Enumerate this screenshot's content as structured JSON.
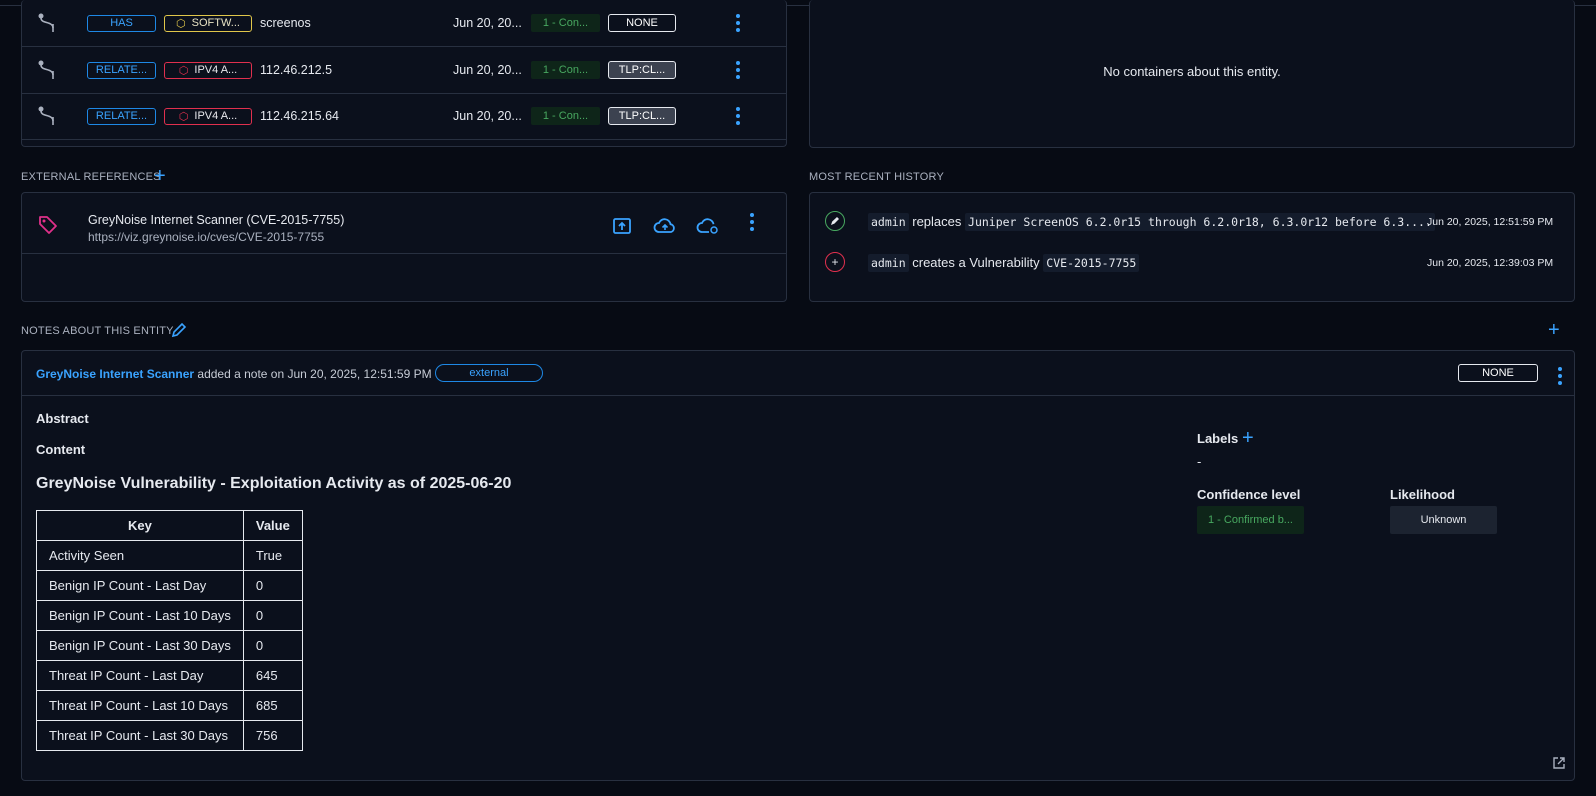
{
  "relations": {
    "rows": [
      {
        "type": "HAS",
        "entity_type": "SOFTW...",
        "entity_color": "yellow",
        "name": "screenos",
        "date": "Jun 20, 20...",
        "confidence": "1 - Con...",
        "marking": "NONE"
      },
      {
        "type": "RELATE...",
        "entity_type": "IPV4 A...",
        "entity_color": "red",
        "name": "112.46.212.5",
        "date": "Jun 20, 20...",
        "confidence": "1 - Con...",
        "marking": "TLP:CL..."
      },
      {
        "type": "RELATE...",
        "entity_type": "IPV4 A...",
        "entity_color": "red",
        "name": "112.46.215.64",
        "date": "Jun 20, 20...",
        "confidence": "1 - Con...",
        "marking": "TLP:CL..."
      }
    ]
  },
  "containers": {
    "empty_text": "No containers about this entity."
  },
  "external_references": {
    "title": "EXTERNAL REFERENCES",
    "items": [
      {
        "title": "GreyNoise Internet Scanner (CVE-2015-7755)",
        "url": "https://viz.greynoise.io/cves/CVE-2015-7755"
      }
    ]
  },
  "history": {
    "title": "MOST RECENT HISTORY",
    "items": [
      {
        "user": "admin",
        "action": "replaces",
        "target": "Juniper ScreenOS 6.2.0r15 through 6.2.0r18, 6.3.0r12 before 6.3....",
        "time": "Jun 20, 2025, 12:51:59 PM",
        "kind": "edit"
      },
      {
        "user": "admin",
        "action": "creates a Vulnerability",
        "target": "CVE-2015-7755",
        "time": "Jun 20, 2025, 12:39:03 PM",
        "kind": "create"
      }
    ]
  },
  "notes": {
    "title": "NOTES ABOUT THIS ENTITY",
    "author": "GreyNoise Internet Scanner",
    "meta": "added a note on Jun 20, 2025, 12:51:59 PM",
    "badge": "external",
    "marking": "NONE",
    "abstract_label": "Abstract",
    "content_label": "Content",
    "heading": "GreyNoise Vulnerability - Exploitation Activity as of 2025-06-20",
    "table_headers": [
      "Key",
      "Value"
    ],
    "table_rows": [
      [
        "Activity Seen",
        "True"
      ],
      [
        "Benign IP Count - Last Day",
        "0"
      ],
      [
        "Benign IP Count - Last 10 Days",
        "0"
      ],
      [
        "Benign IP Count - Last 30 Days",
        "0"
      ],
      [
        "Threat IP Count - Last Day",
        "645"
      ],
      [
        "Threat IP Count - Last 10 Days",
        "685"
      ],
      [
        "Threat IP Count - Last 30 Days",
        "756"
      ]
    ],
    "labels_title": "Labels",
    "labels_value": "-",
    "confidence_title": "Confidence level",
    "confidence_value": "1 - Confirmed b...",
    "likelihood_title": "Likelihood",
    "likelihood_value": "Unknown"
  },
  "colors": {
    "accent": "#3aa3ff",
    "background": "#070b14",
    "panel": "#0b101c",
    "border": "#283040",
    "confidence_green": "#48a860",
    "tag_pink": "#e0308a"
  }
}
